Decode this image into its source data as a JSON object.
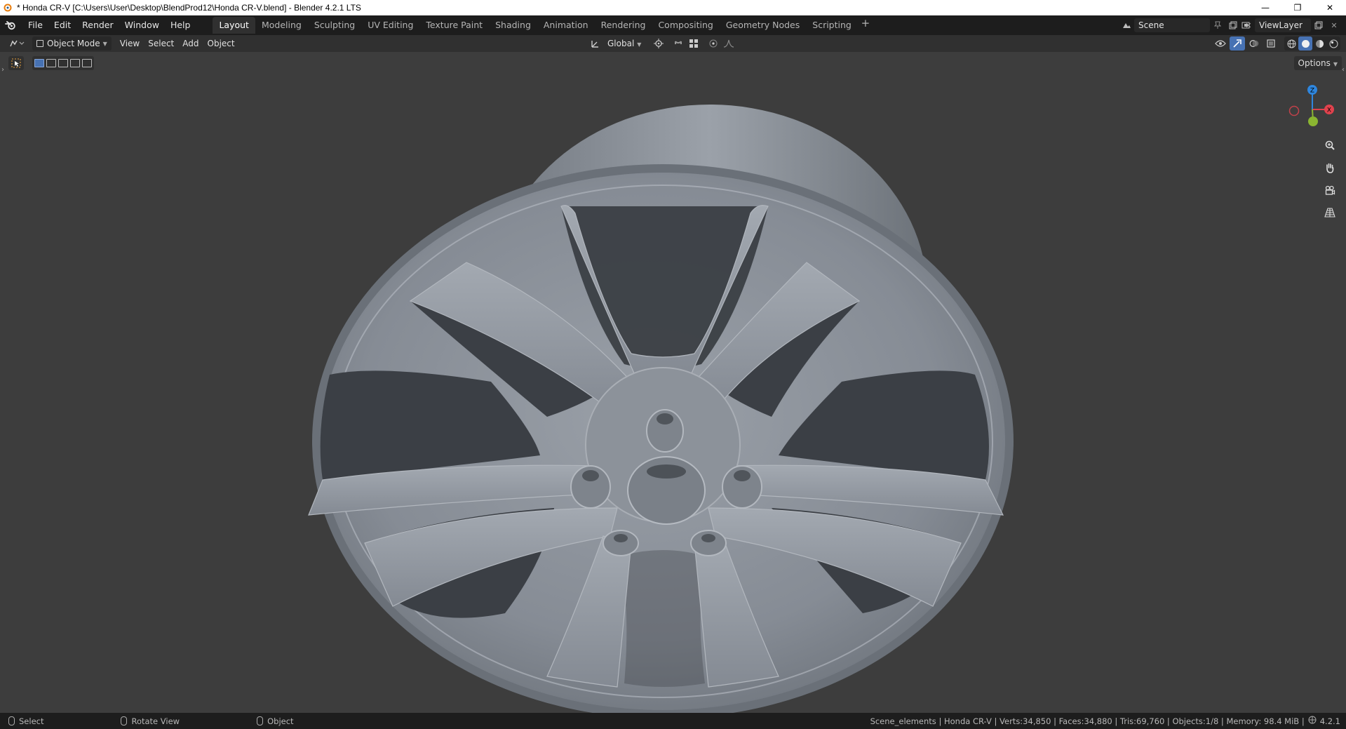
{
  "window": {
    "title": "* Honda CR-V [C:\\Users\\User\\Desktop\\BlendProd12\\Honda CR-V.blend] - Blender 4.2.1 LTS",
    "minimize": "—",
    "restore": "❐",
    "close": "✕"
  },
  "menus": [
    "File",
    "Edit",
    "Render",
    "Window",
    "Help"
  ],
  "workspaces": [
    "Layout",
    "Modeling",
    "Sculpting",
    "UV Editing",
    "Texture Paint",
    "Shading",
    "Animation",
    "Rendering",
    "Compositing",
    "Geometry Nodes",
    "Scripting"
  ],
  "workspace_add": "+",
  "scene": {
    "name": "Scene"
  },
  "view_layer": {
    "name": "ViewLayer"
  },
  "viewport_header": {
    "mode": "Object Mode",
    "menus": [
      "View",
      "Select",
      "Add",
      "Object"
    ],
    "transform_orientation": "Global"
  },
  "viewport": {
    "options_label": "Options",
    "gizmo_axes": {
      "z": "Z",
      "x": "X"
    }
  },
  "statusbar": {
    "select": "Select",
    "rotate_view": "Rotate View",
    "object": "Object",
    "info": "Scene_elements | Honda CR-V | Verts:34,850 | Faces:34,880 | Tris:69,760 | Objects:1/8 | Memory: 98.4 MiB |",
    "version": "4.2.1"
  },
  "colors": {
    "accent": "#4772b3",
    "axis_x": "#e0424d",
    "axis_y": "#8ab531",
    "axis_z": "#2e86de",
    "wheel": "#8a9098"
  }
}
